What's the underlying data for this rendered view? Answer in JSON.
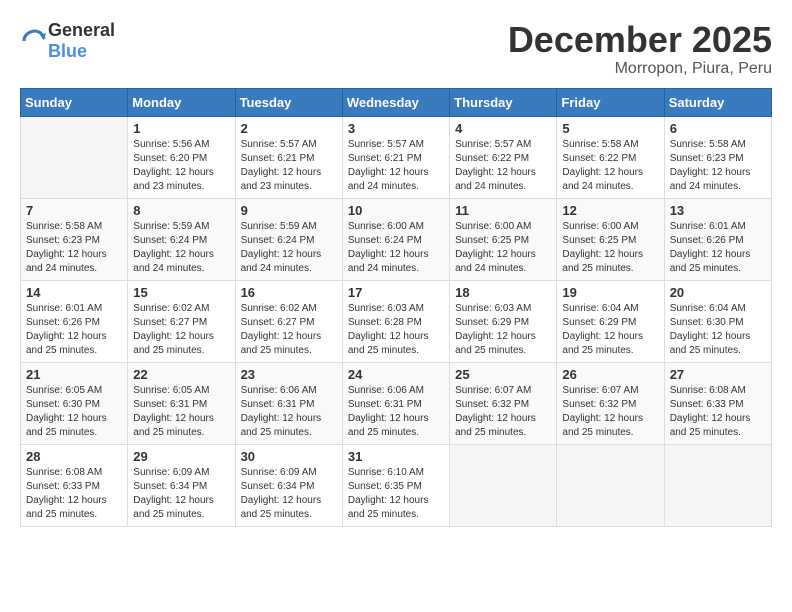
{
  "header": {
    "logo_general": "General",
    "logo_blue": "Blue",
    "month": "December 2025",
    "location": "Morropon, Piura, Peru"
  },
  "weekdays": [
    "Sunday",
    "Monday",
    "Tuesday",
    "Wednesday",
    "Thursday",
    "Friday",
    "Saturday"
  ],
  "weeks": [
    [
      {
        "day": "",
        "sunrise": "",
        "sunset": "",
        "daylight": ""
      },
      {
        "day": "1",
        "sunrise": "Sunrise: 5:56 AM",
        "sunset": "Sunset: 6:20 PM",
        "daylight": "Daylight: 12 hours and 23 minutes."
      },
      {
        "day": "2",
        "sunrise": "Sunrise: 5:57 AM",
        "sunset": "Sunset: 6:21 PM",
        "daylight": "Daylight: 12 hours and 23 minutes."
      },
      {
        "day": "3",
        "sunrise": "Sunrise: 5:57 AM",
        "sunset": "Sunset: 6:21 PM",
        "daylight": "Daylight: 12 hours and 24 minutes."
      },
      {
        "day": "4",
        "sunrise": "Sunrise: 5:57 AM",
        "sunset": "Sunset: 6:22 PM",
        "daylight": "Daylight: 12 hours and 24 minutes."
      },
      {
        "day": "5",
        "sunrise": "Sunrise: 5:58 AM",
        "sunset": "Sunset: 6:22 PM",
        "daylight": "Daylight: 12 hours and 24 minutes."
      },
      {
        "day": "6",
        "sunrise": "Sunrise: 5:58 AM",
        "sunset": "Sunset: 6:23 PM",
        "daylight": "Daylight: 12 hours and 24 minutes."
      }
    ],
    [
      {
        "day": "7",
        "sunrise": "Sunrise: 5:58 AM",
        "sunset": "Sunset: 6:23 PM",
        "daylight": "Daylight: 12 hours and 24 minutes."
      },
      {
        "day": "8",
        "sunrise": "Sunrise: 5:59 AM",
        "sunset": "Sunset: 6:24 PM",
        "daylight": "Daylight: 12 hours and 24 minutes."
      },
      {
        "day": "9",
        "sunrise": "Sunrise: 5:59 AM",
        "sunset": "Sunset: 6:24 PM",
        "daylight": "Daylight: 12 hours and 24 minutes."
      },
      {
        "day": "10",
        "sunrise": "Sunrise: 6:00 AM",
        "sunset": "Sunset: 6:24 PM",
        "daylight": "Daylight: 12 hours and 24 minutes."
      },
      {
        "day": "11",
        "sunrise": "Sunrise: 6:00 AM",
        "sunset": "Sunset: 6:25 PM",
        "daylight": "Daylight: 12 hours and 24 minutes."
      },
      {
        "day": "12",
        "sunrise": "Sunrise: 6:00 AM",
        "sunset": "Sunset: 6:25 PM",
        "daylight": "Daylight: 12 hours and 25 minutes."
      },
      {
        "day": "13",
        "sunrise": "Sunrise: 6:01 AM",
        "sunset": "Sunset: 6:26 PM",
        "daylight": "Daylight: 12 hours and 25 minutes."
      }
    ],
    [
      {
        "day": "14",
        "sunrise": "Sunrise: 6:01 AM",
        "sunset": "Sunset: 6:26 PM",
        "daylight": "Daylight: 12 hours and 25 minutes."
      },
      {
        "day": "15",
        "sunrise": "Sunrise: 6:02 AM",
        "sunset": "Sunset: 6:27 PM",
        "daylight": "Daylight: 12 hours and 25 minutes."
      },
      {
        "day": "16",
        "sunrise": "Sunrise: 6:02 AM",
        "sunset": "Sunset: 6:27 PM",
        "daylight": "Daylight: 12 hours and 25 minutes."
      },
      {
        "day": "17",
        "sunrise": "Sunrise: 6:03 AM",
        "sunset": "Sunset: 6:28 PM",
        "daylight": "Daylight: 12 hours and 25 minutes."
      },
      {
        "day": "18",
        "sunrise": "Sunrise: 6:03 AM",
        "sunset": "Sunset: 6:29 PM",
        "daylight": "Daylight: 12 hours and 25 minutes."
      },
      {
        "day": "19",
        "sunrise": "Sunrise: 6:04 AM",
        "sunset": "Sunset: 6:29 PM",
        "daylight": "Daylight: 12 hours and 25 minutes."
      },
      {
        "day": "20",
        "sunrise": "Sunrise: 6:04 AM",
        "sunset": "Sunset: 6:30 PM",
        "daylight": "Daylight: 12 hours and 25 minutes."
      }
    ],
    [
      {
        "day": "21",
        "sunrise": "Sunrise: 6:05 AM",
        "sunset": "Sunset: 6:30 PM",
        "daylight": "Daylight: 12 hours and 25 minutes."
      },
      {
        "day": "22",
        "sunrise": "Sunrise: 6:05 AM",
        "sunset": "Sunset: 6:31 PM",
        "daylight": "Daylight: 12 hours and 25 minutes."
      },
      {
        "day": "23",
        "sunrise": "Sunrise: 6:06 AM",
        "sunset": "Sunset: 6:31 PM",
        "daylight": "Daylight: 12 hours and 25 minutes."
      },
      {
        "day": "24",
        "sunrise": "Sunrise: 6:06 AM",
        "sunset": "Sunset: 6:31 PM",
        "daylight": "Daylight: 12 hours and 25 minutes."
      },
      {
        "day": "25",
        "sunrise": "Sunrise: 6:07 AM",
        "sunset": "Sunset: 6:32 PM",
        "daylight": "Daylight: 12 hours and 25 minutes."
      },
      {
        "day": "26",
        "sunrise": "Sunrise: 6:07 AM",
        "sunset": "Sunset: 6:32 PM",
        "daylight": "Daylight: 12 hours and 25 minutes."
      },
      {
        "day": "27",
        "sunrise": "Sunrise: 6:08 AM",
        "sunset": "Sunset: 6:33 PM",
        "daylight": "Daylight: 12 hours and 25 minutes."
      }
    ],
    [
      {
        "day": "28",
        "sunrise": "Sunrise: 6:08 AM",
        "sunset": "Sunset: 6:33 PM",
        "daylight": "Daylight: 12 hours and 25 minutes."
      },
      {
        "day": "29",
        "sunrise": "Sunrise: 6:09 AM",
        "sunset": "Sunset: 6:34 PM",
        "daylight": "Daylight: 12 hours and 25 minutes."
      },
      {
        "day": "30",
        "sunrise": "Sunrise: 6:09 AM",
        "sunset": "Sunset: 6:34 PM",
        "daylight": "Daylight: 12 hours and 25 minutes."
      },
      {
        "day": "31",
        "sunrise": "Sunrise: 6:10 AM",
        "sunset": "Sunset: 6:35 PM",
        "daylight": "Daylight: 12 hours and 25 minutes."
      },
      {
        "day": "",
        "sunrise": "",
        "sunset": "",
        "daylight": ""
      },
      {
        "day": "",
        "sunrise": "",
        "sunset": "",
        "daylight": ""
      },
      {
        "day": "",
        "sunrise": "",
        "sunset": "",
        "daylight": ""
      }
    ]
  ]
}
